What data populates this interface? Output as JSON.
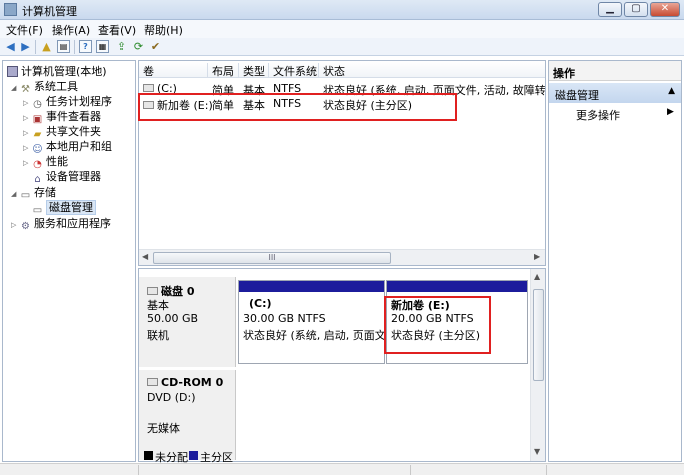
{
  "window": {
    "title": "计算机管理"
  },
  "menu": [
    "文件(F)",
    "操作(A)",
    "查看(V)",
    "帮助(H)"
  ],
  "toolbar_icons": [
    "back-arrow-icon",
    "forward-arrow-icon",
    "up-folder-icon",
    "console-tree-icon",
    "help-icon",
    "properties-icon",
    "export-icon",
    "refresh-icon"
  ],
  "tree": {
    "root": "计算机管理(本地)",
    "system_tools": "系统工具",
    "task_scheduler": "任务计划程序",
    "event_viewer": "事件查看器",
    "shared_folders": "共享文件夹",
    "local_users": "本地用户和组",
    "performance": "性能",
    "device_manager": "设备管理器",
    "storage": "存储",
    "disk_management": "磁盘管理",
    "services": "服务和应用程序"
  },
  "volume_list": {
    "columns": [
      "卷",
      "布局",
      "类型",
      "文件系统",
      "状态"
    ],
    "rows": [
      {
        "volume": "(C:)",
        "layout": "简单",
        "type": "基本",
        "fs": "NTFS",
        "status": "状态良好 (系统, 启动, 页面文件, 活动, 故障转储, ."
      },
      {
        "volume": "新加卷 (E:)",
        "layout": "简单",
        "type": "基本",
        "fs": "NTFS",
        "status": "状态良好 (主分区)"
      }
    ],
    "scroll_thumb": "III"
  },
  "disks": {
    "disk0": {
      "name": "磁盘 0",
      "type": "基本",
      "size": "50.00 GB",
      "status": "联机",
      "partitions": [
        {
          "name": "(C:)",
          "size": "30.00 GB NTFS",
          "status": "状态良好 (系统, 启动, 页面文件"
        },
        {
          "name": "新加卷  (E:)",
          "size": "20.00 GB NTFS",
          "status": "状态良好 (主分区)"
        }
      ]
    },
    "cdrom0": {
      "name": "CD-ROM 0",
      "drive": "DVD (D:)",
      "media": "无媒体"
    }
  },
  "legend": [
    {
      "label": "未分配",
      "color": "#000000"
    },
    {
      "label": "主分区",
      "color": "#1c1c9c"
    }
  ],
  "actions": {
    "header": "操作",
    "section": "磁盘管理",
    "more": "更多操作"
  }
}
